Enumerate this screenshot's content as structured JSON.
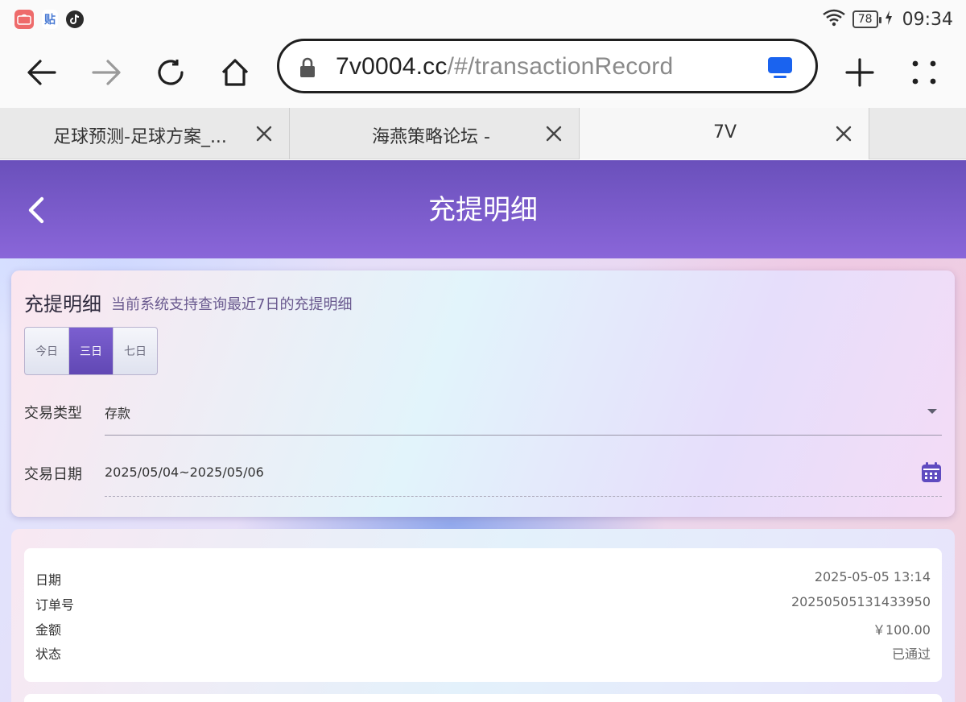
{
  "status_bar": {
    "apps": [
      "store-icon",
      "tieba-icon",
      "tiktok-icon"
    ],
    "tieba_glyph": "贴",
    "battery": "78",
    "time": "09:34"
  },
  "browser": {
    "url_host": "7v0004.cc",
    "url_path": "/#/transactionRecord",
    "tabs": [
      {
        "title": "足球预测-足球方案_..."
      },
      {
        "title": "海燕策略论坛 -"
      },
      {
        "title": "7V"
      }
    ]
  },
  "header": {
    "title": "充提明细"
  },
  "filter": {
    "title": "充提明细",
    "subtitle": "当前系统支持查询最近7日的充提明细",
    "ranges": [
      "今日",
      "三日",
      "七日"
    ],
    "selected_range": "三日",
    "type_label": "交易类型",
    "type_value": "存款",
    "date_label": "交易日期",
    "date_value": "2025/05/04~2025/05/06"
  },
  "records": [
    {
      "date_label": "日期",
      "date": "2025-05-05 13:14",
      "order_label": "订单号",
      "order": "20250505131433950",
      "amount_label": "金额",
      "amount": "￥100.00",
      "status_label": "状态",
      "status": "已通过"
    }
  ],
  "colors": {
    "header": "#6a50bb",
    "accent": "#6148b4"
  }
}
